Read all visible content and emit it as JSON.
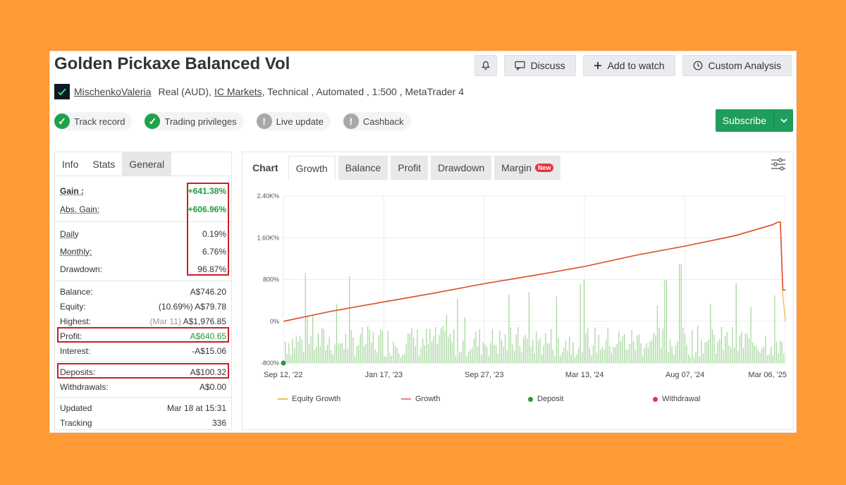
{
  "header": {
    "title": "Golden Pickaxe Balanced Vol",
    "buttons": {
      "discuss": "Discuss",
      "watch": "Add to watch",
      "analysis": "Custom Analysis"
    }
  },
  "meta": {
    "author": "MischenkoValeria",
    "account_type": "Real (AUD),",
    "broker": "IC Markets",
    "details": ", Technical , Automated , 1:500 , MetaTrader 4"
  },
  "badges": [
    {
      "label": "Track record",
      "status": "ok"
    },
    {
      "label": "Trading privileges",
      "status": "ok"
    },
    {
      "label": "Live update",
      "status": "warn"
    },
    {
      "label": "Cashback",
      "status": "warn"
    }
  ],
  "subscribe_label": "Subscribe",
  "left_tabs": [
    "Info",
    "Stats",
    "General"
  ],
  "stats": {
    "gain_label": "Gain :",
    "gain": "+641.38%",
    "abs_label": "Abs. Gain:",
    "abs": "+606.96%",
    "daily_label": "Daily",
    "daily": "0.19%",
    "monthly_label": "Monthly:",
    "monthly": "6.76%",
    "drawdown_label": "Drawdown:",
    "drawdown": "96.87%",
    "balance_label": "Balance:",
    "balance": "A$746.20",
    "equity_label": "Equity:",
    "equity_pct": "(10.69%)",
    "equity": "A$79.78",
    "highest_label": "Highest:",
    "highest_date": "(Mar 11)",
    "highest": "A$1,976.85",
    "profit_label": "Profit:",
    "profit": "A$640.65",
    "interest_label": "Interest:",
    "interest": "-A$15.06",
    "deposits_label": "Deposits:",
    "deposits": "A$100.32",
    "withdrawals_label": "Withdrawals:",
    "withdrawals": "A$0.00",
    "updated_label": "Updated",
    "updated": "Mar 18 at 15:31",
    "tracking_label": "Tracking",
    "tracking": "336"
  },
  "chart_tabs": {
    "chart": "Chart",
    "growth": "Growth",
    "balance": "Balance",
    "profit": "Profit",
    "drawdown": "Drawdown",
    "margin": "Margin",
    "new_tag": "New"
  },
  "colors": {
    "equity": "#e6c24a",
    "growth": "#d9502b",
    "deposit": "#1f9d3a",
    "withdrawal": "#e53935",
    "bars": "#a8d8a0",
    "accent": "#1f9d5c"
  },
  "chart_data": {
    "type": "line",
    "x_ticks": [
      "Sep 12, '22",
      "Jan 17, '23",
      "Sep 27, '23",
      "Mar 13, '24",
      "Aug 07, '24",
      "Mar 06, '25"
    ],
    "y_ticks": [
      "2.40K%",
      "1.60K%",
      "800%",
      "0%",
      "-800%"
    ],
    "ylim": [
      -800,
      2400
    ],
    "grid": true,
    "series": [
      {
        "name": "Equity Growth",
        "x_frac": [
          0,
          0.1,
          0.2,
          0.3,
          0.4,
          0.5,
          0.6,
          0.7,
          0.8,
          0.9,
          0.975,
          0.985,
          0.99,
          0.995,
          1.0
        ],
        "values": [
          0,
          200,
          370,
          540,
          720,
          880,
          1050,
          1260,
          1440,
          1640,
          1850,
          1900,
          1900,
          500,
          0
        ]
      },
      {
        "name": "Growth",
        "x_frac": [
          0,
          0.1,
          0.2,
          0.3,
          0.4,
          0.5,
          0.6,
          0.7,
          0.8,
          0.9,
          0.975,
          0.985,
          0.99,
          0.995,
          1.0
        ],
        "values": [
          0,
          200,
          370,
          540,
          720,
          880,
          1050,
          1260,
          1440,
          1640,
          1850,
          1900,
          1900,
          600,
          600
        ]
      }
    ],
    "legend": [
      "Equity Growth",
      "Growth",
      "Deposit",
      "Withdrawal"
    ],
    "legend_position": "bottom"
  }
}
